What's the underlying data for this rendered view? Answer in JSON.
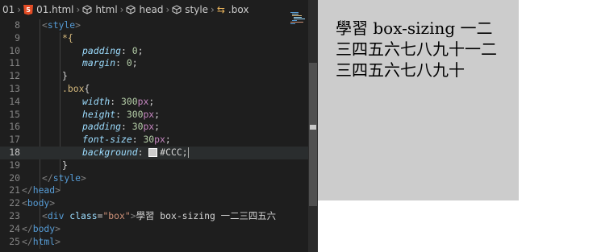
{
  "breadcrumb": {
    "items": [
      {
        "label": "01",
        "icon": "folder"
      },
      {
        "label": "01.html",
        "icon": "html5-icon"
      },
      {
        "label": "html",
        "icon": "cube-icon"
      },
      {
        "label": "head",
        "icon": "cube-icon"
      },
      {
        "label": "style",
        "icon": "cube-icon"
      },
      {
        "label": ".box",
        "icon": "css-selector-icon"
      }
    ],
    "html5_badge": "5"
  },
  "editor": {
    "active_line": 18,
    "lines": [
      {
        "n": "8",
        "indent": 1,
        "tokens": [
          [
            "br",
            "<"
          ],
          [
            "tag",
            "style"
          ],
          [
            "br",
            ">"
          ]
        ]
      },
      {
        "n": "9",
        "indent": 2,
        "tokens": [
          [
            "sel",
            "*{"
          ]
        ]
      },
      {
        "n": "10",
        "indent": 3,
        "tokens": [
          [
            "prop",
            "padding"
          ],
          [
            "txt",
            ": "
          ],
          [
            "num",
            "0"
          ],
          [
            "txt",
            ";"
          ]
        ]
      },
      {
        "n": "11",
        "indent": 3,
        "tokens": [
          [
            "prop",
            "margin"
          ],
          [
            "txt",
            ": "
          ],
          [
            "num",
            "0"
          ],
          [
            "txt",
            ";"
          ]
        ]
      },
      {
        "n": "12",
        "indent": 2,
        "tokens": [
          [
            "txt",
            "}"
          ]
        ]
      },
      {
        "n": "13",
        "indent": 2,
        "tokens": [
          [
            "sel",
            ".box"
          ],
          [
            "txt",
            "{"
          ]
        ]
      },
      {
        "n": "14",
        "indent": 3,
        "tokens": [
          [
            "prop",
            "width"
          ],
          [
            "txt",
            ": "
          ],
          [
            "num",
            "300"
          ],
          [
            "unit",
            "px"
          ],
          [
            "txt",
            ";"
          ]
        ]
      },
      {
        "n": "15",
        "indent": 3,
        "tokens": [
          [
            "prop",
            "height"
          ],
          [
            "txt",
            ": "
          ],
          [
            "num",
            "300"
          ],
          [
            "unit",
            "px"
          ],
          [
            "txt",
            ";"
          ]
        ]
      },
      {
        "n": "16",
        "indent": 3,
        "tokens": [
          [
            "prop",
            "padding"
          ],
          [
            "txt",
            ": "
          ],
          [
            "num",
            "30"
          ],
          [
            "unit",
            "px"
          ],
          [
            "txt",
            ";"
          ]
        ]
      },
      {
        "n": "17",
        "indent": 3,
        "tokens": [
          [
            "prop",
            "font-size"
          ],
          [
            "txt",
            ": "
          ],
          [
            "num",
            "30"
          ],
          [
            "unit",
            "px"
          ],
          [
            "txt",
            ";"
          ]
        ]
      },
      {
        "n": "18",
        "indent": 3,
        "tokens": [
          [
            "prop",
            "background"
          ],
          [
            "txt",
            ": "
          ],
          [
            "swatch",
            ""
          ],
          [
            "hash",
            "#CCC"
          ],
          [
            "txt",
            ";"
          ],
          [
            "caret",
            ""
          ]
        ]
      },
      {
        "n": "19",
        "indent": 2,
        "tokens": [
          [
            "txt",
            "}"
          ]
        ]
      },
      {
        "n": "20",
        "indent": 1,
        "tokens": [
          [
            "br",
            "</"
          ],
          [
            "tag",
            "style"
          ],
          [
            "br",
            ">"
          ]
        ]
      },
      {
        "n": "21",
        "indent": 0,
        "tokens": [
          [
            "br",
            "</"
          ],
          [
            "tag",
            "head"
          ],
          [
            "br",
            ">"
          ]
        ]
      },
      {
        "n": "22",
        "indent": 0,
        "tokens": [
          [
            "br",
            "<"
          ],
          [
            "tag",
            "body"
          ],
          [
            "br",
            ">"
          ]
        ]
      },
      {
        "n": "23",
        "indent": 1,
        "tokens": [
          [
            "br",
            "<"
          ],
          [
            "tag",
            "div"
          ],
          [
            "txt",
            " "
          ],
          [
            "attr",
            "class"
          ],
          [
            "txt",
            "="
          ],
          [
            "str",
            "\"box\""
          ],
          [
            "br",
            ">"
          ],
          [
            "txt",
            "學習 box-sizing 一二三四五六"
          ]
        ]
      },
      {
        "n": "24",
        "indent": 0,
        "tokens": [
          [
            "br",
            "</"
          ],
          [
            "tag",
            "body"
          ],
          [
            "br",
            ">"
          ]
        ]
      },
      {
        "n": "25",
        "indent": 0,
        "tokens": [
          [
            "br",
            "</"
          ],
          [
            "tag",
            "html"
          ],
          [
            "br",
            ">"
          ]
        ]
      }
    ]
  },
  "preview": {
    "box_text": "學習 box-sizing 一二三四五六七八九十一二三四五六七八九十",
    "box_color": "#cccccc"
  },
  "colors": {
    "editor_bg": "#1e1e1e",
    "tag": "#569cd6",
    "property": "#9cdcfe",
    "number": "#b5cea8",
    "unit": "#c586c0",
    "selector": "#d7ba7d",
    "string": "#ce9178"
  }
}
